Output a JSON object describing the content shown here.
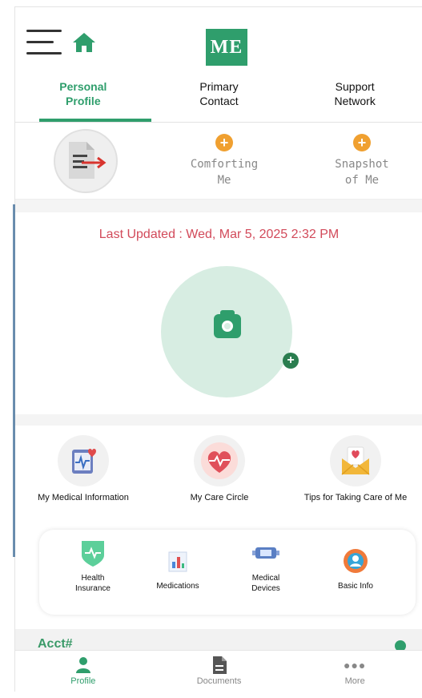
{
  "header": {
    "logo_text": "ME"
  },
  "tabs": [
    {
      "line1": "Personal",
      "line2": "Profile",
      "active": true
    },
    {
      "line1": "Primary",
      "line2": "Contact",
      "active": false
    },
    {
      "line1": "Support",
      "line2": "Network",
      "active": false
    }
  ],
  "subtabs": [
    {
      "icon": "document-export-icon"
    },
    {
      "line1": "Comforting",
      "line2": "Me",
      "icon": "plus-icon"
    },
    {
      "line1": "Snapshot",
      "line2": "of Me",
      "icon": "plus-icon"
    }
  ],
  "profile": {
    "last_updated": "Last Updated : Wed, Mar 5, 2025 2:32 PM"
  },
  "info": [
    {
      "label": "My Medical Information",
      "icon": "medical-clipboard-icon"
    },
    {
      "label": "My Care Circle",
      "icon": "heart-circle-icon"
    },
    {
      "label": "Tips for Taking Care of Me",
      "icon": "envelope-heart-icon"
    }
  ],
  "card_items": [
    {
      "line1": "Health",
      "line2": "Insurance",
      "icon": "shield-pulse-icon"
    },
    {
      "line1": "Medications",
      "line2": "",
      "icon": "medications-icon"
    },
    {
      "line1": "Medical",
      "line2": "Devices",
      "icon": "medical-device-icon"
    },
    {
      "line1": "Basic Info",
      "line2": "",
      "icon": "id-card-icon"
    }
  ],
  "account": {
    "label": "Acct#"
  },
  "bottom_nav": [
    {
      "label": "Profile",
      "active": true,
      "icon": "person-icon"
    },
    {
      "label": "Documents",
      "active": false,
      "icon": "document-icon"
    },
    {
      "label": "More",
      "active": false,
      "icon": "more-dots-icon"
    }
  ],
  "colors": {
    "primary_green": "#2f9e6c",
    "updated_text": "#d24a5a",
    "accent_orange": "#f0a030",
    "photo_bg": "#d7ede2"
  }
}
